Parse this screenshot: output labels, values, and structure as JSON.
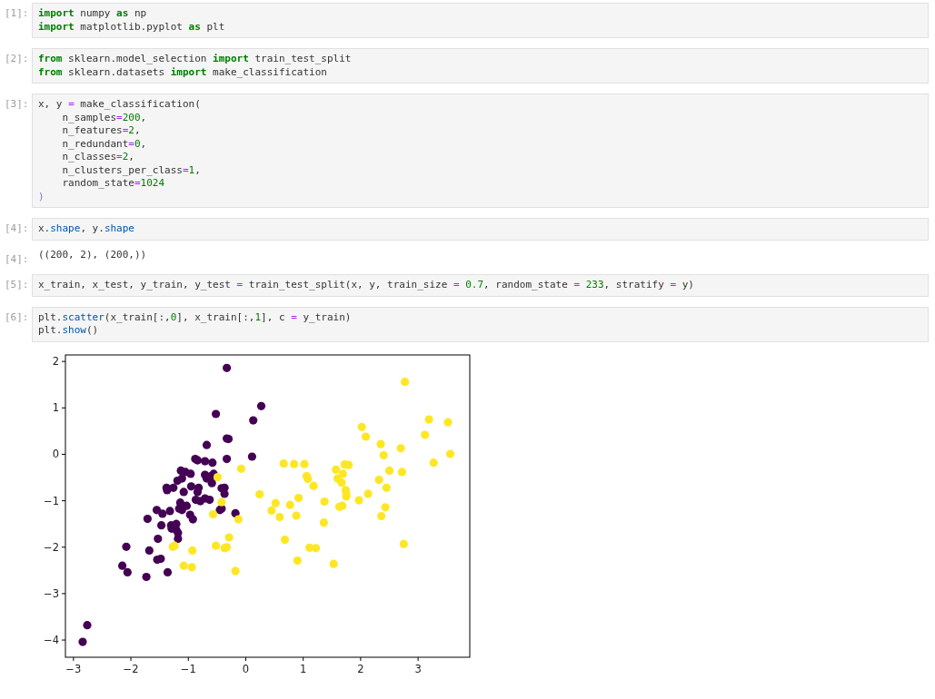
{
  "cells": [
    {
      "kind": "input",
      "prompt": "[1]:",
      "lines": [
        [
          {
            "text": "import",
            "kind": "keyword"
          },
          {
            "text": " numpy ",
            "kind": "plain"
          },
          {
            "text": "as",
            "kind": "keyword"
          },
          {
            "text": " np",
            "kind": "plain"
          }
        ],
        [
          {
            "text": "import",
            "kind": "keyword"
          },
          {
            "text": " matplotlib.pyplot ",
            "kind": "plain"
          },
          {
            "text": "as",
            "kind": "keyword"
          },
          {
            "text": " plt",
            "kind": "plain"
          }
        ]
      ]
    },
    {
      "kind": "input",
      "prompt": "[2]:",
      "lines": [
        [
          {
            "text": "from",
            "kind": "keyword"
          },
          {
            "text": " sklearn.model_selection ",
            "kind": "plain"
          },
          {
            "text": "import",
            "kind": "keyword"
          },
          {
            "text": " train_test_split",
            "kind": "plain"
          }
        ],
        [
          {
            "text": "from",
            "kind": "keyword"
          },
          {
            "text": " sklearn.datasets ",
            "kind": "plain"
          },
          {
            "text": "import",
            "kind": "keyword"
          },
          {
            "text": " make_classification",
            "kind": "plain"
          }
        ]
      ]
    },
    {
      "kind": "input",
      "prompt": "[3]:",
      "lines": [
        [
          {
            "text": "x, y ",
            "kind": "plain"
          },
          {
            "text": "=",
            "kind": "operator"
          },
          {
            "text": " make_classification(",
            "kind": "plain"
          }
        ],
        [
          {
            "text": "    n_samples",
            "kind": "plain"
          },
          {
            "text": "=",
            "kind": "operator"
          },
          {
            "text": "200",
            "kind": "number"
          },
          {
            "text": ",",
            "kind": "plain"
          }
        ],
        [
          {
            "text": "    n_features",
            "kind": "plain"
          },
          {
            "text": "=",
            "kind": "operator"
          },
          {
            "text": "2",
            "kind": "number"
          },
          {
            "text": ",",
            "kind": "plain"
          }
        ],
        [
          {
            "text": "    n_redundant",
            "kind": "plain"
          },
          {
            "text": "=",
            "kind": "operator"
          },
          {
            "text": "0",
            "kind": "number"
          },
          {
            "text": ",",
            "kind": "plain"
          }
        ],
        [
          {
            "text": "    n_classes",
            "kind": "plain"
          },
          {
            "text": "=",
            "kind": "operator"
          },
          {
            "text": "2",
            "kind": "number"
          },
          {
            "text": ",",
            "kind": "plain"
          }
        ],
        [
          {
            "text": "    n_clusters_per_class",
            "kind": "plain"
          },
          {
            "text": "=",
            "kind": "operator"
          },
          {
            "text": "1",
            "kind": "number"
          },
          {
            "text": ",",
            "kind": "plain"
          }
        ],
        [
          {
            "text": "    random_state",
            "kind": "plain"
          },
          {
            "text": "=",
            "kind": "operator"
          },
          {
            "text": "1024",
            "kind": "number"
          }
        ],
        [
          {
            "text": ")",
            "kind": "bracket"
          }
        ]
      ]
    },
    {
      "kind": "input",
      "prompt": "[4]:",
      "lines": [
        [
          {
            "text": "x.",
            "kind": "plain"
          },
          {
            "text": "shape",
            "kind": "property"
          },
          {
            "text": ", y.",
            "kind": "plain"
          },
          {
            "text": "shape",
            "kind": "property"
          }
        ]
      ]
    },
    {
      "kind": "output",
      "prompt": "[4]:",
      "text": "((200, 2), (200,))"
    },
    {
      "kind": "input",
      "prompt": "[5]:",
      "lines": [
        [
          {
            "text": "x_train, x_test, y_train, y_test ",
            "kind": "plain"
          },
          {
            "text": "=",
            "kind": "operator"
          },
          {
            "text": " train_test_split(x, y, train_size ",
            "kind": "plain"
          },
          {
            "text": "= ",
            "kind": "operator"
          },
          {
            "text": "0.7",
            "kind": "number"
          },
          {
            "text": ", random_state ",
            "kind": "plain"
          },
          {
            "text": "= ",
            "kind": "operator"
          },
          {
            "text": "233",
            "kind": "number"
          },
          {
            "text": ", stratify ",
            "kind": "plain"
          },
          {
            "text": "=",
            "kind": "operator"
          },
          {
            "text": " y)",
            "kind": "plain"
          }
        ]
      ]
    },
    {
      "kind": "input",
      "prompt": "[6]:",
      "lines": [
        [
          {
            "text": "plt.",
            "kind": "plain"
          },
          {
            "text": "scatter",
            "kind": "property"
          },
          {
            "text": "(x_train[:,",
            "kind": "plain"
          },
          {
            "text": "0",
            "kind": "number"
          },
          {
            "text": "], x_train[:,",
            "kind": "plain"
          },
          {
            "text": "1",
            "kind": "number"
          },
          {
            "text": "], c ",
            "kind": "plain"
          },
          {
            "text": "=",
            "kind": "operator"
          },
          {
            "text": " y_train)",
            "kind": "plain"
          }
        ],
        [
          {
            "text": "plt.",
            "kind": "plain"
          },
          {
            "text": "show",
            "kind": "property"
          },
          {
            "text": "()",
            "kind": "plain"
          }
        ]
      ]
    },
    {
      "kind": "chart",
      "chart_data": {
        "type": "scatter",
        "xlim": [
          -3.14,
          3.9
        ],
        "ylim": [
          -4.37,
          2.14
        ],
        "xticks": [
          {
            "value": -3,
            "label": "−3"
          },
          {
            "value": -2,
            "label": "−2"
          },
          {
            "value": -1,
            "label": "−1"
          },
          {
            "value": 0,
            "label": "0"
          },
          {
            "value": 1,
            "label": "1"
          },
          {
            "value": 2,
            "label": "2"
          },
          {
            "value": 3,
            "label": "3"
          }
        ],
        "yticks": [
          {
            "value": -4,
            "label": "−4"
          },
          {
            "value": -3,
            "label": "−3"
          },
          {
            "value": -2,
            "label": "−2"
          },
          {
            "value": -1,
            "label": "−1"
          },
          {
            "value": 0,
            "label": "0"
          },
          {
            "value": 1,
            "label": "1"
          },
          {
            "value": 2,
            "label": "2"
          }
        ],
        "series": [
          {
            "color": "#440154",
            "x": [
              -0.33,
              -0.52,
              0.27,
              0.13,
              -0.68,
              -0.33,
              -0.3,
              -0.33,
              0.11,
              -0.88,
              -0.84,
              -0.71,
              -0.58,
              -1.13,
              -1.05,
              -0.96,
              -1.19,
              -1.11,
              -0.71,
              -0.68,
              -0.61,
              -0.56,
              -1.38,
              -1.37,
              -1.26,
              -0.95,
              -0.59,
              -0.82,
              -0.84,
              -1.08,
              -0.42,
              -0.37,
              -0.37,
              -0.87,
              -0.79,
              -0.63,
              -0.71,
              -1.14,
              -1.03,
              -1.16,
              -1.11,
              -0.45,
              -0.42,
              -1.32,
              -1.55,
              -1.45,
              -0.97,
              -0.92,
              -1.71,
              -0.18,
              -1.47,
              -1.3,
              -1.21,
              -1.29,
              -1.21,
              -1.18,
              -1.18,
              -1.53,
              -2.08,
              -1.68,
              -1.54,
              -1.48,
              -2.15,
              -2.06,
              -1.73,
              -1.36,
              -2.76,
              -2.84
            ],
            "values": [
              1.86,
              0.87,
              1.04,
              0.73,
              0.2,
              0.34,
              0.33,
              -0.1,
              -0.05,
              -0.1,
              -0.13,
              -0.15,
              -0.18,
              -0.35,
              -0.38,
              -0.42,
              -0.57,
              -0.52,
              -0.44,
              -0.52,
              -0.47,
              -0.42,
              -0.72,
              -0.77,
              -0.72,
              -0.69,
              -0.62,
              -0.72,
              -0.81,
              -0.81,
              -0.73,
              -0.72,
              -0.85,
              -0.98,
              -1.01,
              -0.98,
              -0.95,
              -1.04,
              -1.11,
              -1.17,
              -1.2,
              -1.2,
              -1.17,
              -1.22,
              -1.2,
              -1.28,
              -1.3,
              -1.4,
              -1.39,
              -1.27,
              -1.53,
              -1.53,
              -1.5,
              -1.6,
              -1.63,
              -1.69,
              -1.82,
              -1.82,
              -1.99,
              -2.07,
              -2.27,
              -2.25,
              -2.4,
              -2.54,
              -2.64,
              -2.54,
              -3.68,
              -4.04
            ]
          },
          {
            "color": "#fde725",
            "x": [
              -0.08,
              -0.49,
              0.24,
              -0.42,
              -0.57,
              -0.13,
              -0.29,
              -0.52,
              -0.37,
              -0.33,
              -1.27,
              -1.24,
              -0.93,
              -1.08,
              -0.94,
              -0.18,
              2.77,
              3.19,
              3.52,
              2.02,
              2.09,
              3.12,
              2.35,
              2.4,
              2.7,
              3.56,
              3.27,
              0.66,
              0.84,
              1.02,
              1.72,
              1.79,
              1.57,
              1.69,
              1.06,
              1.08,
              1.6,
              1.67,
              1.18,
              2.5,
              2.72,
              2.32,
              2.45,
              1.74,
              1.75,
              1.75,
              2.13,
              1.97,
              0.92,
              0.52,
              0.77,
              1.37,
              1.63,
              1.68,
              2.43,
              0.45,
              0.59,
              0.88,
              2.36,
              1.36,
              0.68,
              1.11,
              1.22,
              2.75,
              0.9,
              1.53
            ],
            "values": [
              -0.31,
              -0.49,
              -0.86,
              -1.03,
              -1.29,
              -1.4,
              -1.79,
              -1.97,
              -2.02,
              -2.0,
              -1.99,
              -1.97,
              -2.07,
              -2.4,
              -2.43,
              -2.51,
              1.56,
              0.75,
              0.69,
              0.59,
              0.38,
              0.42,
              0.22,
              -0.02,
              0.13,
              0.01,
              -0.18,
              -0.2,
              -0.21,
              -0.21,
              -0.22,
              -0.23,
              -0.33,
              -0.42,
              -0.47,
              -0.53,
              -0.52,
              -0.61,
              -0.68,
              -0.35,
              -0.38,
              -0.55,
              -0.72,
              -0.77,
              -0.85,
              -0.91,
              -0.85,
              -0.99,
              -0.94,
              -1.05,
              -1.09,
              -1.02,
              -1.13,
              -1.11,
              -1.14,
              -1.21,
              -1.35,
              -1.32,
              -1.33,
              -1.47,
              -1.84,
              -2.01,
              -2.02,
              -1.93,
              -2.29,
              -2.36
            ]
          }
        ]
      }
    }
  ]
}
